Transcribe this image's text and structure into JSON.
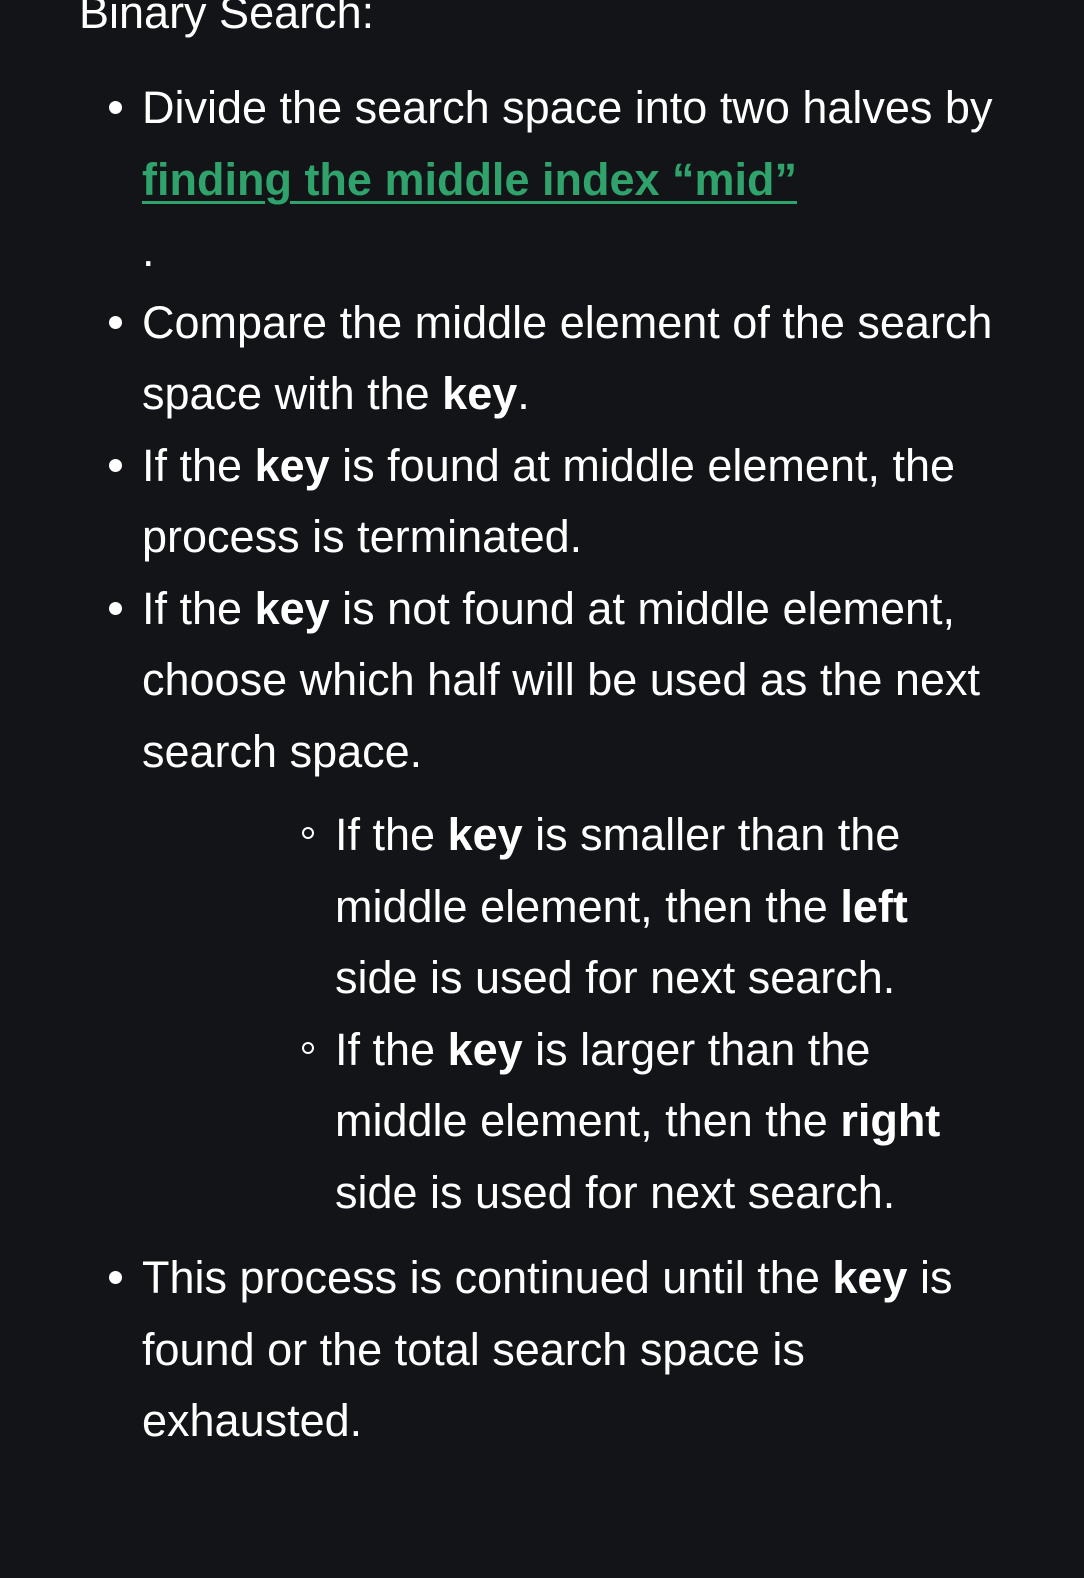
{
  "heading": "Binary Search:",
  "steps": {
    "divide": {
      "text_before": "Divide the search space into two halves by ",
      "link_text": "finding the middle index “mid”",
      "text_after": "."
    },
    "compare": {
      "text_before": "Compare the middle element of the search space with the ",
      "bold": "key",
      "text_after": "."
    },
    "found": {
      "text_before": "If the ",
      "bold": "key",
      "text_after": " is found at middle element, the process is terminated."
    },
    "not_found": {
      "text_before": "If the ",
      "bold": "key",
      "text_after": " is not found at middle element, choose which half will be used as the next search space.",
      "sub": {
        "smaller": {
          "text_before": "If the ",
          "bold": "key",
          "text_middle": " is smaller than the middle element, then the ",
          "bold2": "left",
          "text_after": " side is used for next search."
        },
        "larger": {
          "text_before": "If the ",
          "bold": "key",
          "text_middle": " is larger than the middle element, then the ",
          "bold2": "right",
          "text_after": " side is used for next search."
        }
      }
    },
    "continue": {
      "text_before": "This process is continued until the ",
      "bold": "key",
      "text_after": " is found or the total search space is exhausted."
    }
  },
  "colors": {
    "background": "#131417",
    "text": "#ffffff",
    "link": "#2fa36b"
  }
}
